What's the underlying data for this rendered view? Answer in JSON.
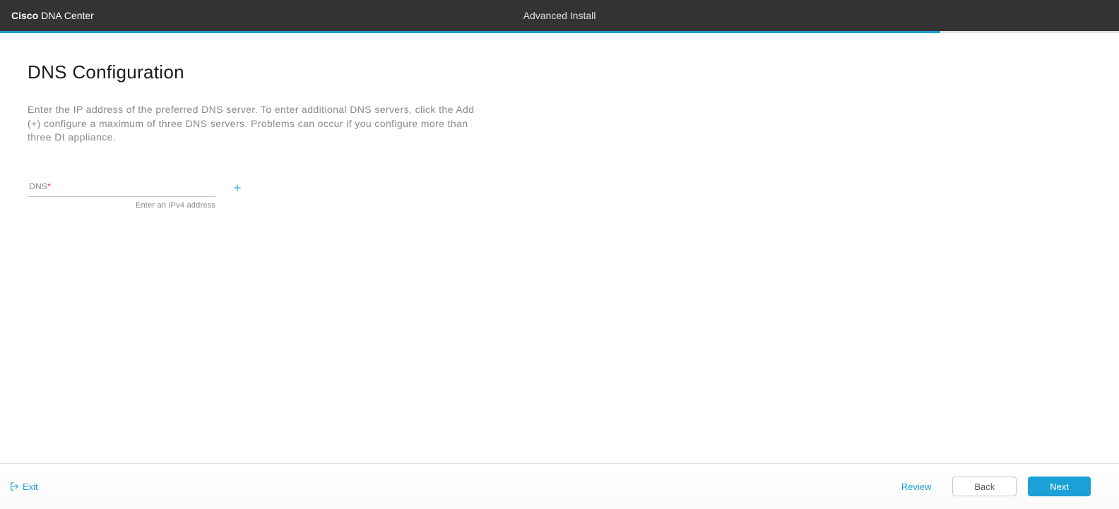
{
  "header": {
    "brand_bold": "Cisco",
    "brand_rest": "DNA Center",
    "center_title": "Advanced Install"
  },
  "page": {
    "title": "DNS Configuration",
    "description": "Enter the IP address of the preferred DNS server. To enter additional DNS servers, click the Add (+) configure a maximum of three DNS servers. Problems can occur if you configure more than three DI appliance."
  },
  "form": {
    "dns": {
      "label": "DNS",
      "required_mark": "*",
      "value": "",
      "helper": "Enter an IPv4 address"
    }
  },
  "footer": {
    "exit_label": "Exit",
    "review_label": "Review",
    "back_label": "Back",
    "next_label": "Next"
  }
}
